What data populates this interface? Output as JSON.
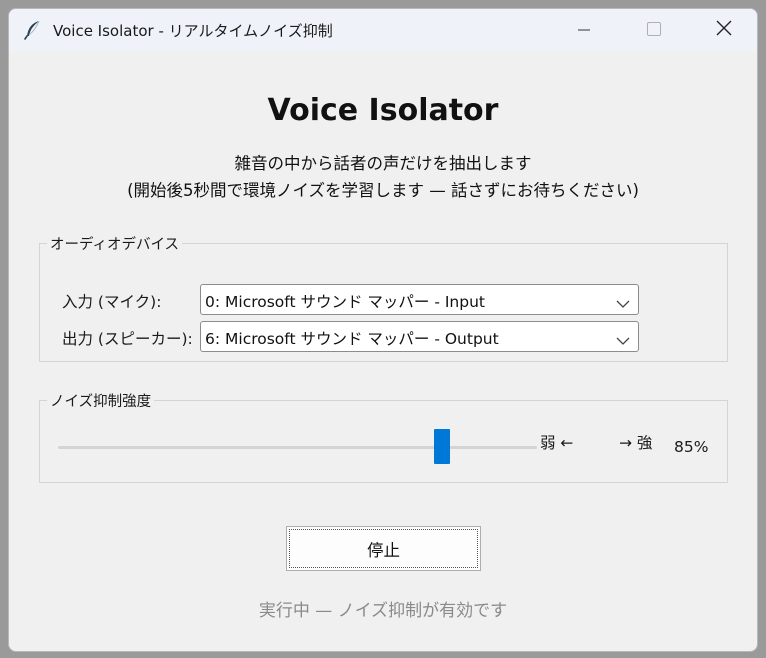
{
  "window": {
    "title": "Voice Isolator - リアルタイムノイズ抑制"
  },
  "header": {
    "title": "Voice Isolator",
    "subtitle_line1": "雑音の中から話者の声だけを抽出します",
    "subtitle_line2": "(開始後5秒間で環境ノイズを学習します — 話さずにお待ちください)"
  },
  "audio_devices": {
    "legend": "オーディオデバイス",
    "input_label": "入力 (マイク):",
    "input_value": "0: Microsoft サウンド マッパー - Input",
    "output_label": "出力 (スピーカー):",
    "output_value": "6: Microsoft サウンド マッパー - Output"
  },
  "noise_suppression": {
    "legend": "ノイズ抑制強度",
    "weak_label": "弱 ←",
    "strong_label": "→ 強",
    "value_percent": 85,
    "value_text": "85%"
  },
  "controls": {
    "stop_label": "停止"
  },
  "status": {
    "text": "実行中 — ノイズ抑制が有効です"
  },
  "colors": {
    "accent": "#0078d7",
    "window_bg": "#f0f0f0",
    "titlebar_bg": "#eff3f9",
    "status_text": "#8a8a8a"
  },
  "icons": {
    "app": "feather-icon",
    "minimize": "minimize-icon",
    "maximize": "maximize-icon",
    "close": "close-icon",
    "dropdown": "chevron-down-icon"
  }
}
